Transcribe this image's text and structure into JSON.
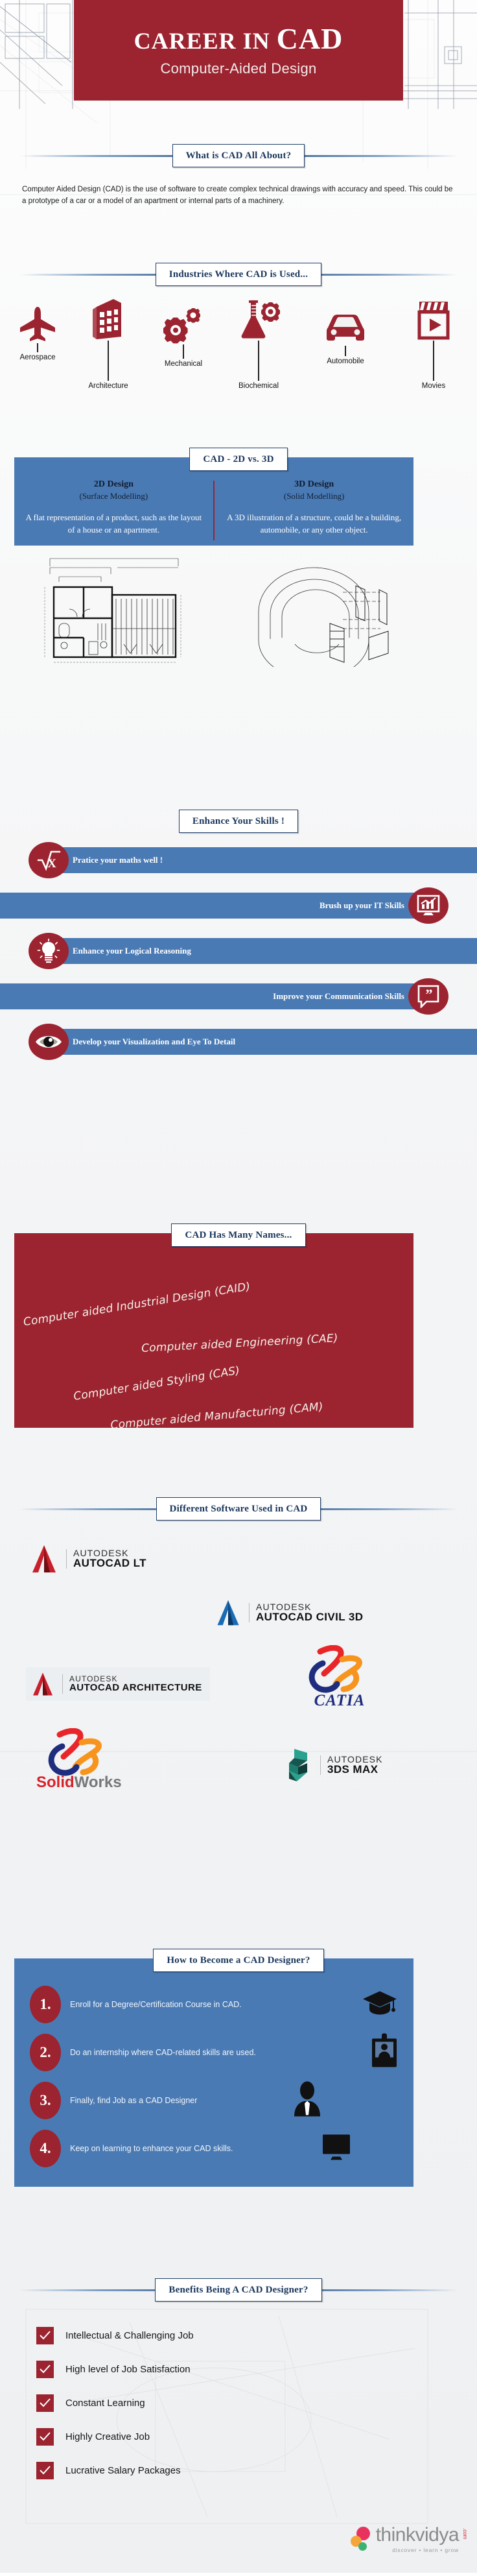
{
  "header": {
    "title_main": "CAREER IN ",
    "title_accent": "CAD",
    "subtitle": "Computer-Aided Design"
  },
  "what_is_cad": {
    "heading": "What is CAD All About?",
    "body": "Computer Aided Design (CAD) is the use of software to create complex technical drawings with accuracy and speed. This could be a prototype of a car or a model of an apartment or internal parts of a machinery."
  },
  "industries": {
    "heading": "Industries Where CAD is Used...",
    "items": [
      {
        "label": "Aerospace",
        "icon": "airplane-icon"
      },
      {
        "label": "Architecture",
        "icon": "building-icon"
      },
      {
        "label": "Mechanical",
        "icon": "gears-icon"
      },
      {
        "label": "Biochemical",
        "icon": "flask-gear-icon"
      },
      {
        "label": "Automobile",
        "icon": "car-icon"
      },
      {
        "label": "Movies",
        "icon": "clapperboard-play-icon"
      }
    ]
  },
  "two_vs_three": {
    "heading": "CAD - 2D vs. 3D",
    "left": {
      "title": "2D Design",
      "subtitle": "(Surface Modelling)",
      "desc": "A flat representation of a product, such as the layout of a house or an apartment.",
      "image": "floor-plan-drawing"
    },
    "right": {
      "title": "3D Design",
      "subtitle": "(Solid Modelling)",
      "desc": "A 3D illustration of a structure, could be a building, automobile, or any other object.",
      "image": "3d-curved-structure-drawing"
    }
  },
  "skills": {
    "heading": "Enhance Your Skills !",
    "items": [
      {
        "label": "Pratice your maths well !",
        "icon": "square-root-x-icon",
        "side": "left"
      },
      {
        "label": "Brush up your IT Skills",
        "icon": "monitor-chart-icon",
        "side": "right"
      },
      {
        "label": "Enhance your Logical Reasoning",
        "icon": "lightbulb-icon",
        "side": "left"
      },
      {
        "label": "Improve your Communication Skills",
        "icon": "quote-bubble-icon",
        "side": "right"
      },
      {
        "label": "Develop your Visualization and Eye To Detail",
        "icon": "eye-icon",
        "side": "left"
      }
    ]
  },
  "many_names": {
    "heading": "CAD Has Many Names...",
    "items": [
      "Computer aided Industrial Design (CAID)",
      "Computer aided Engineering (CAE)",
      "Computer aided Styling (CAS)",
      "Computer aided Manufacturing (CAM)"
    ]
  },
  "software": {
    "heading": "Different Software Used in CAD",
    "items": [
      {
        "brand": "AUTODESK",
        "product": "AUTOCAD LT",
        "logo": "autodesk-a-icon",
        "color": "#c8202c"
      },
      {
        "brand": "AUTODESK",
        "product": "AUTOCAD CIVIL 3D",
        "logo": "autodesk-a-icon",
        "color": "#1a6bb5"
      },
      {
        "brand": "AUTODESK",
        "product": "AUTOCAD ARCHITECTURE",
        "logo": "autodesk-a-icon",
        "color": "#c8202c"
      },
      {
        "brand": "",
        "product": "CATIA",
        "logo": "dassault-3ds-icon",
        "color": "#1e2d7d"
      },
      {
        "brand": "",
        "product": "SolidWorks",
        "logo": "dassault-3ds-icon",
        "color": "#d6232b"
      },
      {
        "brand": "AUTODESK",
        "product": "3DS MAX",
        "logo": "autodesk-3dsmax-icon",
        "color": "#168a7a"
      }
    ],
    "solidworks_part1": "Solid",
    "solidworks_part2": "Works"
  },
  "how_to": {
    "heading": "How to Become a CAD Designer?",
    "steps": [
      {
        "num": "1.",
        "text": "Enroll for a Degree/Certification Course in CAD.",
        "icon": "graduation-cap-icon"
      },
      {
        "num": "2.",
        "text": "Do an internship where CAD-related skills are used.",
        "icon": "id-badge-icon"
      },
      {
        "num": "3.",
        "text": "Finally, find Job as a CAD Designer",
        "icon": "businessman-icon"
      },
      {
        "num": "4.",
        "text": "Keep on learning to enhance your CAD skills.",
        "icon": "monitor-icon"
      }
    ]
  },
  "benefits": {
    "heading": "Benefits Being A CAD Designer?",
    "items": [
      "Intellectual & Challenging Job",
      "High level of Job Satisfaction",
      "Constant Learning",
      "Highly Creative Job",
      "Lucrative Salary Packages"
    ]
  },
  "brand": {
    "name": "thinkvidya",
    "domain": ".com",
    "tagline": "discover • learn • grow"
  },
  "colors": {
    "red": "#9b2430",
    "blue": "#4a7ab4",
    "navy": "#19365c"
  }
}
